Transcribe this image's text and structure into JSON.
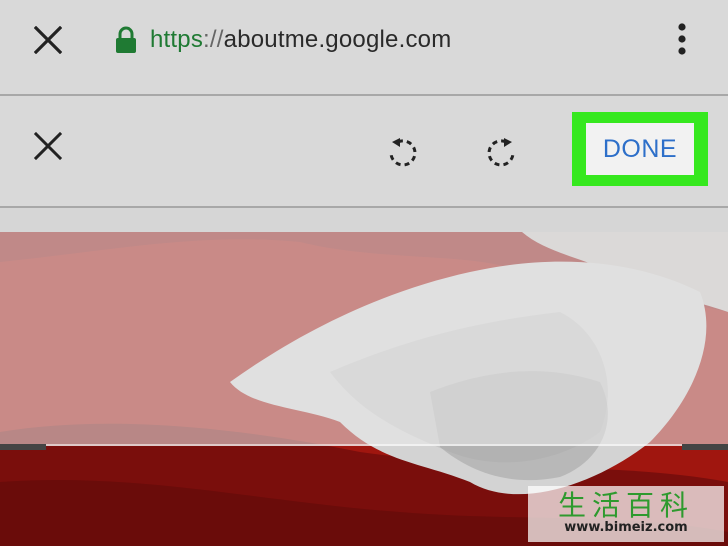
{
  "browser": {
    "url_scheme": "https",
    "url_separator": "://",
    "url_host": "aboutme.google.com",
    "icons": {
      "close": "close-icon",
      "lock": "lock-icon",
      "menu": "more-vert-icon"
    }
  },
  "editor": {
    "done_label": "DONE",
    "icons": {
      "close": "close-icon",
      "rotate_left": "rotate-left-icon",
      "rotate_right": "rotate-right-icon"
    }
  },
  "watermark": {
    "title": "生活百科",
    "url": "www.bimeiz.com"
  },
  "colors": {
    "accent_green": "#36e81e",
    "done_text": "#2d6fc9",
    "lock_green": "#1f7a33"
  }
}
